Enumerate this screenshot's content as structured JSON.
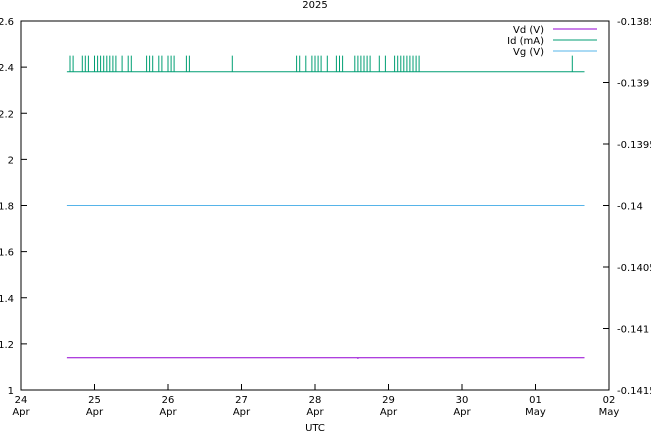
{
  "chart_data": {
    "type": "line",
    "title": "2025",
    "xlabel": "UTC",
    "ylabel": "",
    "y2label": "",
    "x_range": [
      "2025-04-24",
      "2025-05-02"
    ],
    "x_ticks": [
      {
        "date": "2025-04-24",
        "day": "24",
        "month": "Apr"
      },
      {
        "date": "2025-04-25",
        "day": "25",
        "month": "Apr"
      },
      {
        "date": "2025-04-26",
        "day": "26",
        "month": "Apr"
      },
      {
        "date": "2025-04-27",
        "day": "27",
        "month": "Apr"
      },
      {
        "date": "2025-04-28",
        "day": "28",
        "month": "Apr"
      },
      {
        "date": "2025-04-29",
        "day": "29",
        "month": "Apr"
      },
      {
        "date": "2025-04-30",
        "day": "30",
        "month": "Apr"
      },
      {
        "date": "2025-05-01",
        "day": "01",
        "month": "May"
      },
      {
        "date": "2025-05-02",
        "day": "02",
        "month": "May"
      }
    ],
    "ylim": [
      1,
      2.6
    ],
    "y_ticks": [
      "1",
      "1.2",
      "1.4",
      "1.6",
      "1.8",
      "2",
      "2.2",
      "2.4",
      "2.6"
    ],
    "y2lim": [
      -0.1415,
      -0.1385
    ],
    "y2_ticks": [
      "-0.1415",
      "-0.141",
      "-0.1405",
      "-0.14",
      "-0.1395",
      "-0.139",
      "-0.1385"
    ],
    "grid": false,
    "legend_position": "top-right",
    "series": [
      {
        "name": "Vd (V)",
        "color": "#9400d3",
        "axis": "y1",
        "start": "2025-04-24 15:00",
        "end": "2025-05-01 16:00",
        "value": 1.14,
        "dips": [
          {
            "t": "2025-04-28 14:00",
            "value": 1.135
          }
        ]
      },
      {
        "name": "Id (mA)",
        "color": "#009e73",
        "axis": "y1",
        "start": "2025-04-24 15:00",
        "end": "2025-05-01 16:00",
        "value": 2.38,
        "spike_value": 2.45,
        "spikes": [
          "2025-04-24 16:00",
          "2025-04-24 17:00",
          "2025-04-24 20:00",
          "2025-04-24 21:00",
          "2025-04-24 22:00",
          "2025-04-25 00:00",
          "2025-04-25 01:00",
          "2025-04-25 02:00",
          "2025-04-25 03:00",
          "2025-04-25 04:00",
          "2025-04-25 05:00",
          "2025-04-25 06:00",
          "2025-04-25 07:00",
          "2025-04-25 09:00",
          "2025-04-25 11:00",
          "2025-04-25 12:00",
          "2025-04-25 17:00",
          "2025-04-25 18:00",
          "2025-04-25 19:00",
          "2025-04-25 21:00",
          "2025-04-25 22:00",
          "2025-04-26 00:00",
          "2025-04-26 01:00",
          "2025-04-26 02:00",
          "2025-04-26 06:00",
          "2025-04-26 07:00",
          "2025-04-26 21:00",
          "2025-04-27 18:00",
          "2025-04-27 19:00",
          "2025-04-27 21:00",
          "2025-04-27 23:00",
          "2025-04-28 00:00",
          "2025-04-28 01:00",
          "2025-04-28 02:00",
          "2025-04-28 04:00",
          "2025-04-28 07:00",
          "2025-04-28 08:00",
          "2025-04-28 09:00",
          "2025-04-28 13:00",
          "2025-04-28 14:00",
          "2025-04-28 15:00",
          "2025-04-28 16:00",
          "2025-04-28 17:00",
          "2025-04-28 18:00",
          "2025-04-28 21:00",
          "2025-04-28 23:00",
          "2025-04-29 02:00",
          "2025-04-29 03:00",
          "2025-04-29 04:00",
          "2025-04-29 05:00",
          "2025-04-29 06:00",
          "2025-04-29 07:00",
          "2025-04-29 08:00",
          "2025-04-29 09:00",
          "2025-04-29 10:00",
          "2025-05-01 12:00"
        ]
      },
      {
        "name": "Vg (V)",
        "color": "#56b4e9",
        "axis": "y2",
        "start": "2025-04-24 15:00",
        "end": "2025-05-01 16:00",
        "value": -0.14
      }
    ]
  }
}
